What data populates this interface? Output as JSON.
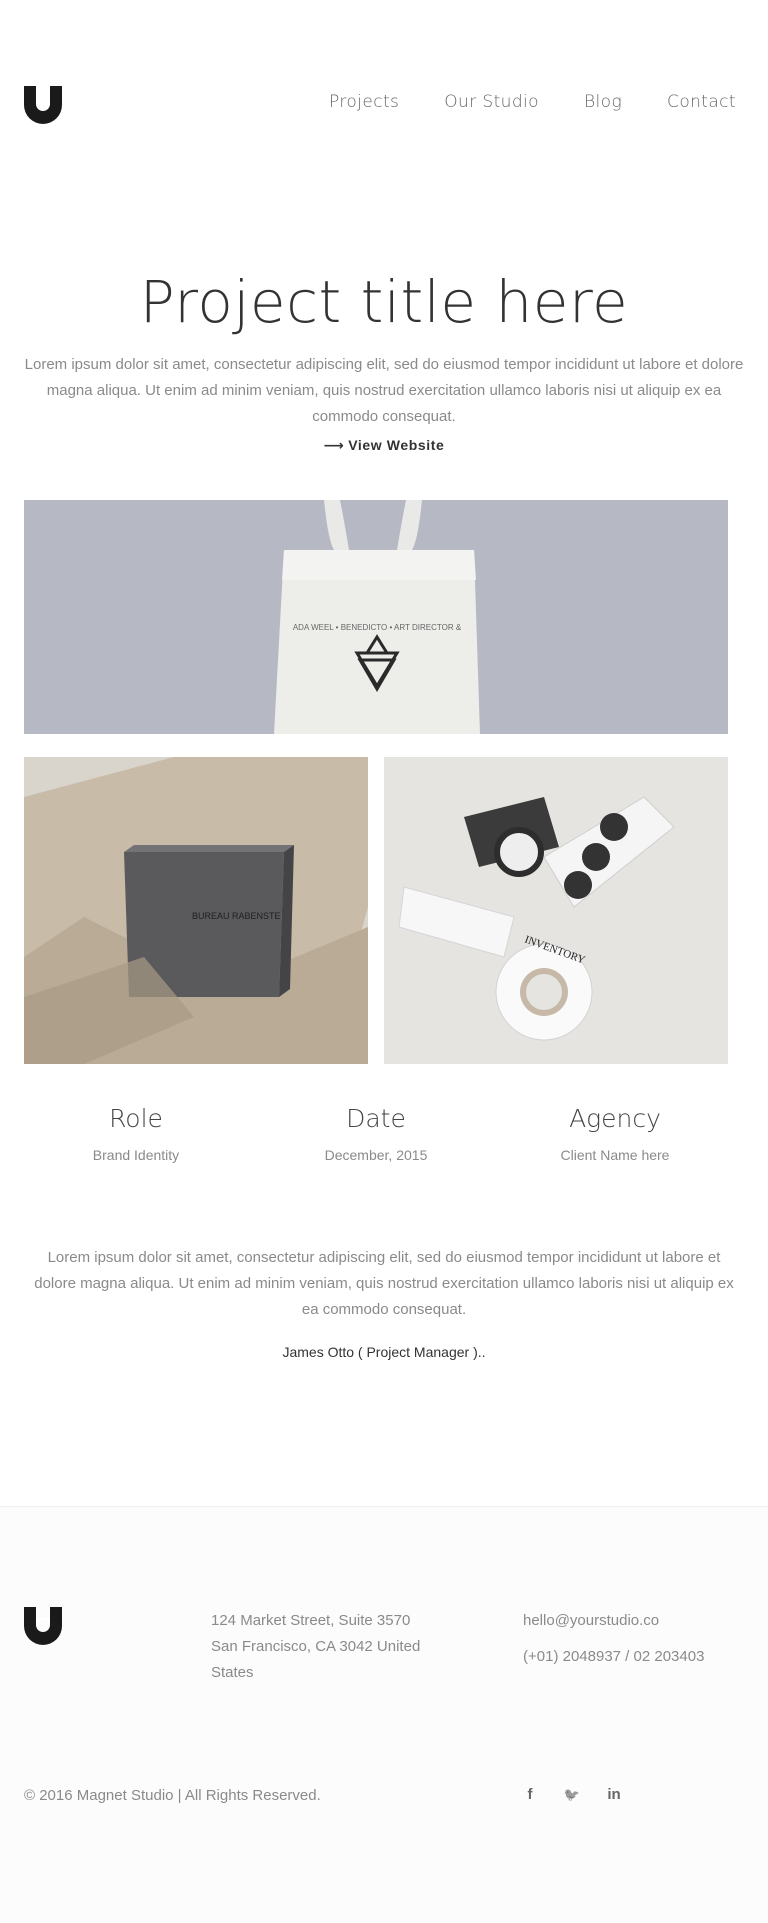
{
  "nav": {
    "items": [
      {
        "label": "Projects"
      },
      {
        "label": "Our Studio"
      },
      {
        "label": "Blog"
      },
      {
        "label": "Contact"
      }
    ]
  },
  "project": {
    "title": "Project title here",
    "intro": "Lorem ipsum dolor sit amet, consectetur adipiscing elit, sed do eiusmod tempor incididunt ut labore et dolore magna aliqua. Ut enim ad minim veniam, quis nostrud exercitation ullamco laboris nisi ut aliquip ex ea commodo consequat.",
    "view_label": "View Website",
    "view_icon": "arrow-right-icon"
  },
  "images": {
    "tote_print": "ADA WEEL • BENEDICTO • ART DIRECTOR &",
    "box_label": "BUREAU RABENSTE",
    "tape_label": "INVENTORY"
  },
  "info": {
    "role_heading": "Role",
    "role_value": "Brand Identity",
    "date_heading": "Date",
    "date_value": "December, 2015",
    "agency_heading": "Agency",
    "agency_value": "Client Name here"
  },
  "body_text": "Lorem ipsum dolor sit amet, consectetur adipiscing elit, sed do eiusmod tempor incididunt ut labore et dolore magna aliqua. Ut enim ad minim veniam, quis nostrud exercitation ullamco laboris nisi ut aliquip ex ea commodo consequat.",
  "quote": "James Otto ( Project Manager )..",
  "footer": {
    "address_line1": "124 Market Street, Suite 3570",
    "address_line2": "San Francisco, CA 3042 United States",
    "email": "hello@yourstudio.co",
    "phone": "(+01) 2048937 / 02 203403",
    "copyright": "© 2016 Magnet Studio | All Rights Reserved.",
    "social": [
      {
        "label": "f",
        "icon": "facebook-icon"
      },
      {
        "label": "🐦",
        "icon": "twitter-icon"
      },
      {
        "label": "in",
        "icon": "linkedin-icon"
      }
    ]
  },
  "colors": {
    "text_dark": "#333333",
    "text_muted": "#8a8a8a",
    "logo": "#1a1a1a",
    "tote_bg": "#b6b9c3"
  }
}
